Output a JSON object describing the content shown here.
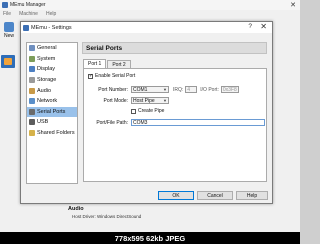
{
  "manager": {
    "title": "MEmu Manager",
    "menu": [
      "File",
      "Machine",
      "Help"
    ],
    "new_label": "New",
    "audio_heading": "Audio",
    "audio_row": "Host Driver:  Windows DirectSound",
    "close_glyph": "✕"
  },
  "dialog": {
    "title": "MEmu - Settings",
    "help_glyph": "?",
    "close_glyph": "✕",
    "nav_items": [
      {
        "label": "General",
        "icon": "general-icon",
        "selected": false
      },
      {
        "label": "System",
        "icon": "system-icon",
        "selected": false
      },
      {
        "label": "Display",
        "icon": "display-icon",
        "selected": false
      },
      {
        "label": "Storage",
        "icon": "storage-icon",
        "selected": false
      },
      {
        "label": "Audio",
        "icon": "audio-icon",
        "selected": false
      },
      {
        "label": "Network",
        "icon": "network-icon",
        "selected": false
      },
      {
        "label": "Serial Ports",
        "icon": "serial-ports-icon",
        "selected": true
      },
      {
        "label": "USB",
        "icon": "usb-icon",
        "selected": false
      },
      {
        "label": "Shared Folders",
        "icon": "shared-folders-icon",
        "selected": false
      }
    ],
    "section_title": "Serial Ports",
    "tabs": [
      "Port 1",
      "Port 2"
    ],
    "enable_serial_port": "Enable Serial Port",
    "port_number_label": "Port Number:",
    "port_number_value": "COM1",
    "irq_label": "IRQ:",
    "irq_value": "4",
    "io_port_label": "I/O Port:",
    "io_port_value": "0x3F8",
    "port_mode_label": "Port Mode:",
    "port_mode_value": "Host Pipe",
    "create_pipe_label": "Create Pipe",
    "port_path_label": "Port/File Path:",
    "port_path_value": "COM3",
    "ok_label": "OK",
    "cancel_label": "Cancel",
    "help_label": "Help"
  },
  "caption": "778x595  62kb  JPEG",
  "colors": {
    "selection": "#99c1ea",
    "vm_icon": "#2e6db8"
  }
}
